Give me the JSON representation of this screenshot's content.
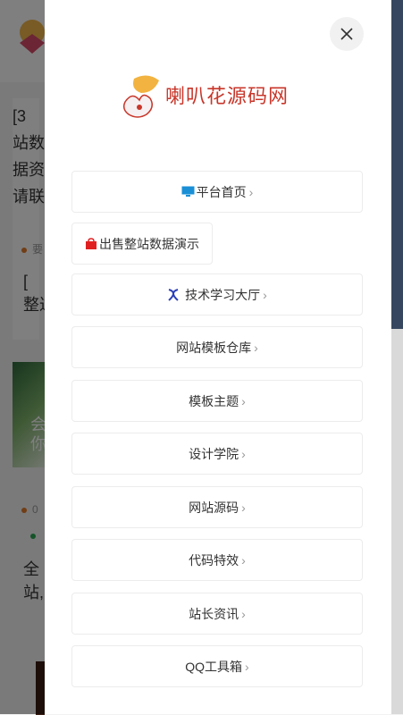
{
  "background": {
    "text_lines": [
      "[3",
      "站数",
      "据资",
      "请联"
    ],
    "meta1": "要",
    "pin_text1": "[",
    "pin_line2": "整达",
    "card2_text1": "会",
    "card2_text2": "你",
    "meta2": "0",
    "pin_text2": "全",
    "pin_line3": "站,"
  },
  "drawer": {
    "close_symbol": "✕",
    "logo_text": "喇叭花源码网",
    "menu": [
      {
        "label": "平台首页",
        "icon": "monitor-icon",
        "chevron": "›"
      },
      {
        "label": "出售整站数据演示",
        "icon": "shopping-bag-icon",
        "chevron": ""
      },
      {
        "label": "技术学习大厅",
        "icon": "dna-icon",
        "chevron": "›"
      },
      {
        "label": "网站模板仓库",
        "icon": "",
        "chevron": "›"
      },
      {
        "label": "模板主题",
        "icon": "",
        "chevron": "›"
      },
      {
        "label": "设计学院",
        "icon": "",
        "chevron": "›"
      },
      {
        "label": "网站源码",
        "icon": "",
        "chevron": "›"
      },
      {
        "label": "代码特效",
        "icon": "",
        "chevron": "›"
      },
      {
        "label": "站长资讯",
        "icon": "",
        "chevron": "›"
      },
      {
        "label": "QQ工具箱",
        "icon": "",
        "chevron": "›"
      }
    ]
  },
  "colors": {
    "overlay": "rgba(0,0,0,0.5)",
    "accent_red": "#c8362a",
    "monitor_blue": "#1a8fd6",
    "bag_red": "#e02020",
    "dna_blue": "#2b3fb8"
  }
}
